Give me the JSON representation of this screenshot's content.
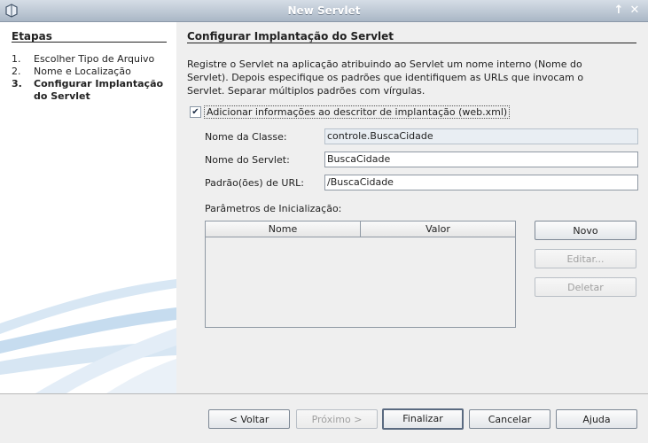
{
  "window": {
    "title": "New Servlet"
  },
  "steps": {
    "header": "Etapas",
    "items": [
      {
        "num": "1.",
        "label": "Escolher Tipo de Arquivo"
      },
      {
        "num": "2.",
        "label": "Nome e Localização"
      },
      {
        "num": "3.",
        "label": "Configurar Implantação do Servlet"
      }
    ]
  },
  "panel": {
    "title": "Configurar Implantação do Servlet",
    "description": "Registre o Servlet na aplicação atribuindo ao Servlet um nome interno (Nome do Servlet). Depois especifique os padrões que identifiquem as URLs que invocam o Servlet. Separar múltiplos padrões com vírgulas.",
    "add_info": {
      "label": "Adicionar informações ao descritor de implantação (web.xml)",
      "checked": true
    },
    "class_name": {
      "label": "Nome da Classe:",
      "value": "controle.BuscaCidade"
    },
    "servlet_name": {
      "label": "Nome do Servlet:",
      "value": "BuscaCidade"
    },
    "url_pattern": {
      "label": "Padrão(ões) de URL:",
      "value": "/BuscaCidade"
    },
    "init_params": {
      "label": "Parâmetros de Inicialização:",
      "columns": [
        "Nome",
        "Valor"
      ],
      "rows": []
    },
    "buttons": {
      "new": "Novo",
      "edit": "Editar...",
      "delete": "Deletar"
    }
  },
  "footer": {
    "back": "< Voltar",
    "next": "Próximo >",
    "finish": "Finalizar",
    "cancel": "Cancelar",
    "help": "Ajuda"
  },
  "colors": {
    "titlebar": "#aab7c6",
    "panel_bg": "#efefef",
    "steps_bg": "#ffffff"
  }
}
